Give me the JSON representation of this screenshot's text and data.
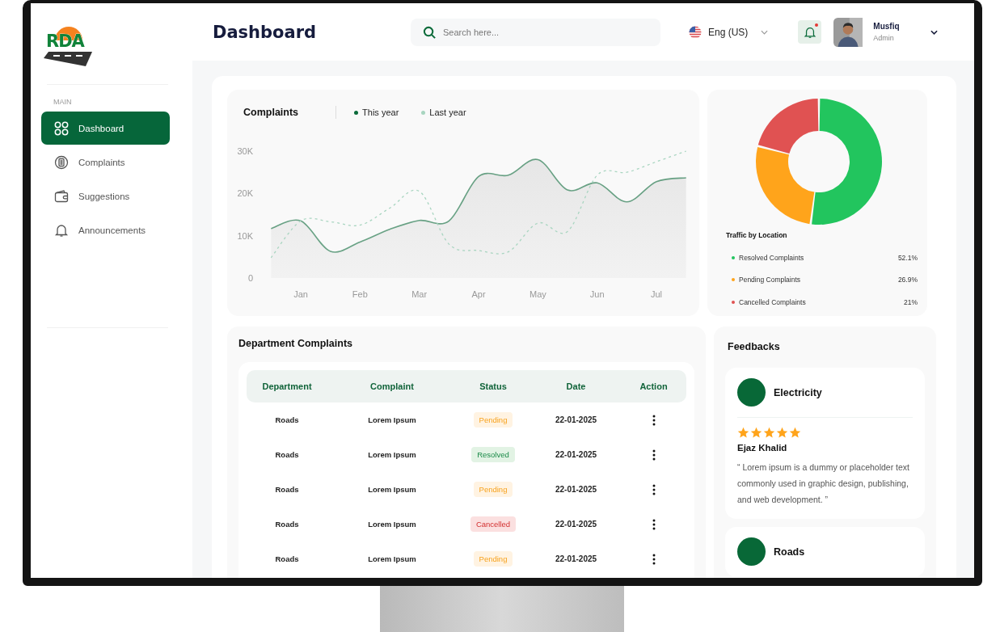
{
  "sidebar": {
    "logo": {
      "text": "RDA"
    },
    "section": "MAIN",
    "items": [
      {
        "label": "Dashboard",
        "kind": "grid",
        "selected": true
      },
      {
        "label": "Complaints",
        "kind": "document",
        "selected": false
      },
      {
        "label": "Suggestions",
        "kind": "wallet",
        "selected": false
      },
      {
        "label": "Announcements",
        "kind": "bell",
        "selected": false
      }
    ]
  },
  "header": {
    "title": "Dashboard",
    "search": {
      "placeholder": "Search here..."
    },
    "language": "Eng (US)",
    "notifications": {
      "unread": true
    },
    "user": {
      "name": "Musfiq",
      "role": "Admin"
    }
  },
  "complaints_chart": {
    "chart_data": {
      "type": "line",
      "title": "Complaints",
      "categories": [
        null,
        "Jan",
        null,
        "Feb",
        null,
        "Mar",
        null,
        "Apr",
        null,
        "May",
        null,
        "Jun",
        null,
        "Jul",
        null
      ],
      "yticks": [
        {
          "value": 0,
          "label": "0"
        },
        {
          "value": 10000,
          "label": "10K"
        },
        {
          "value": 20000,
          "label": "20K"
        },
        {
          "value": 30000,
          "label": "30K"
        }
      ],
      "ylim": [
        0,
        30000
      ],
      "series": [
        {
          "name": "This year",
          "color": "#0b6b3a",
          "line_style": "solid",
          "values": [
            11700,
            13500,
            6300,
            8500,
            11500,
            13600,
            13500,
            24000,
            24300,
            28000,
            20800,
            22500,
            18000,
            22800,
            23700
          ]
        },
        {
          "name": "Last year",
          "color": "#a8d5c0",
          "line_style": "dashed",
          "values": [
            4800,
            13500,
            13300,
            12500,
            16500,
            20500,
            8000,
            6500,
            6200,
            13000,
            11000,
            24300,
            25000,
            27500,
            30000
          ]
        }
      ]
    }
  },
  "traffic": {
    "chart_data": {
      "type": "donut",
      "title": "Traffic by Location",
      "categories": [
        "Resolved Complaints",
        "Pending Complaints",
        "Cancelled Complaints"
      ],
      "values": [
        52.1,
        26.9,
        21
      ]
    },
    "legend": [
      {
        "value": "52.1%",
        "color": "#22c55e"
      },
      {
        "value": "26.9%",
        "color": "#ffa41b"
      },
      {
        "value": "21%",
        "color": "#e05252"
      }
    ]
  },
  "department_complaints": {
    "title": "Department Complaints",
    "columns": [
      "Department",
      "Complaint",
      "Status",
      "Date",
      "Action"
    ],
    "rows": [
      {
        "department": "Roads",
        "complaint": "Lorem Ipsum",
        "status": {
          "label": "Pending",
          "kind": "pending"
        },
        "date": "22-01-2025"
      },
      {
        "department": "Roads",
        "complaint": "Lorem Ipsum",
        "status": {
          "label": "Resolved",
          "kind": "resolved"
        },
        "date": "22-01-2025"
      },
      {
        "department": "Roads",
        "complaint": "Lorem Ipsum",
        "status": {
          "label": "Pending",
          "kind": "pending"
        },
        "date": "22-01-2025"
      },
      {
        "department": "Roads",
        "complaint": "Lorem Ipsum",
        "status": {
          "label": "Cancelled",
          "kind": "cancelled"
        },
        "date": "22-01-2025"
      },
      {
        "department": "Roads",
        "complaint": "Lorem Ipsum",
        "status": {
          "label": "Pending",
          "kind": "pending"
        },
        "date": "22-01-2025"
      }
    ]
  },
  "feedbacks": {
    "title": "Feedbacks",
    "cards": [
      {
        "department": "Electricity",
        "stars": 5,
        "author": "Ejaz Khalid",
        "text": "“ Lorem ipsum is a dummy or placeholder text commonly used in graphic design, publishing, and web development. ”"
      },
      {
        "department": "Roads"
      }
    ]
  }
}
